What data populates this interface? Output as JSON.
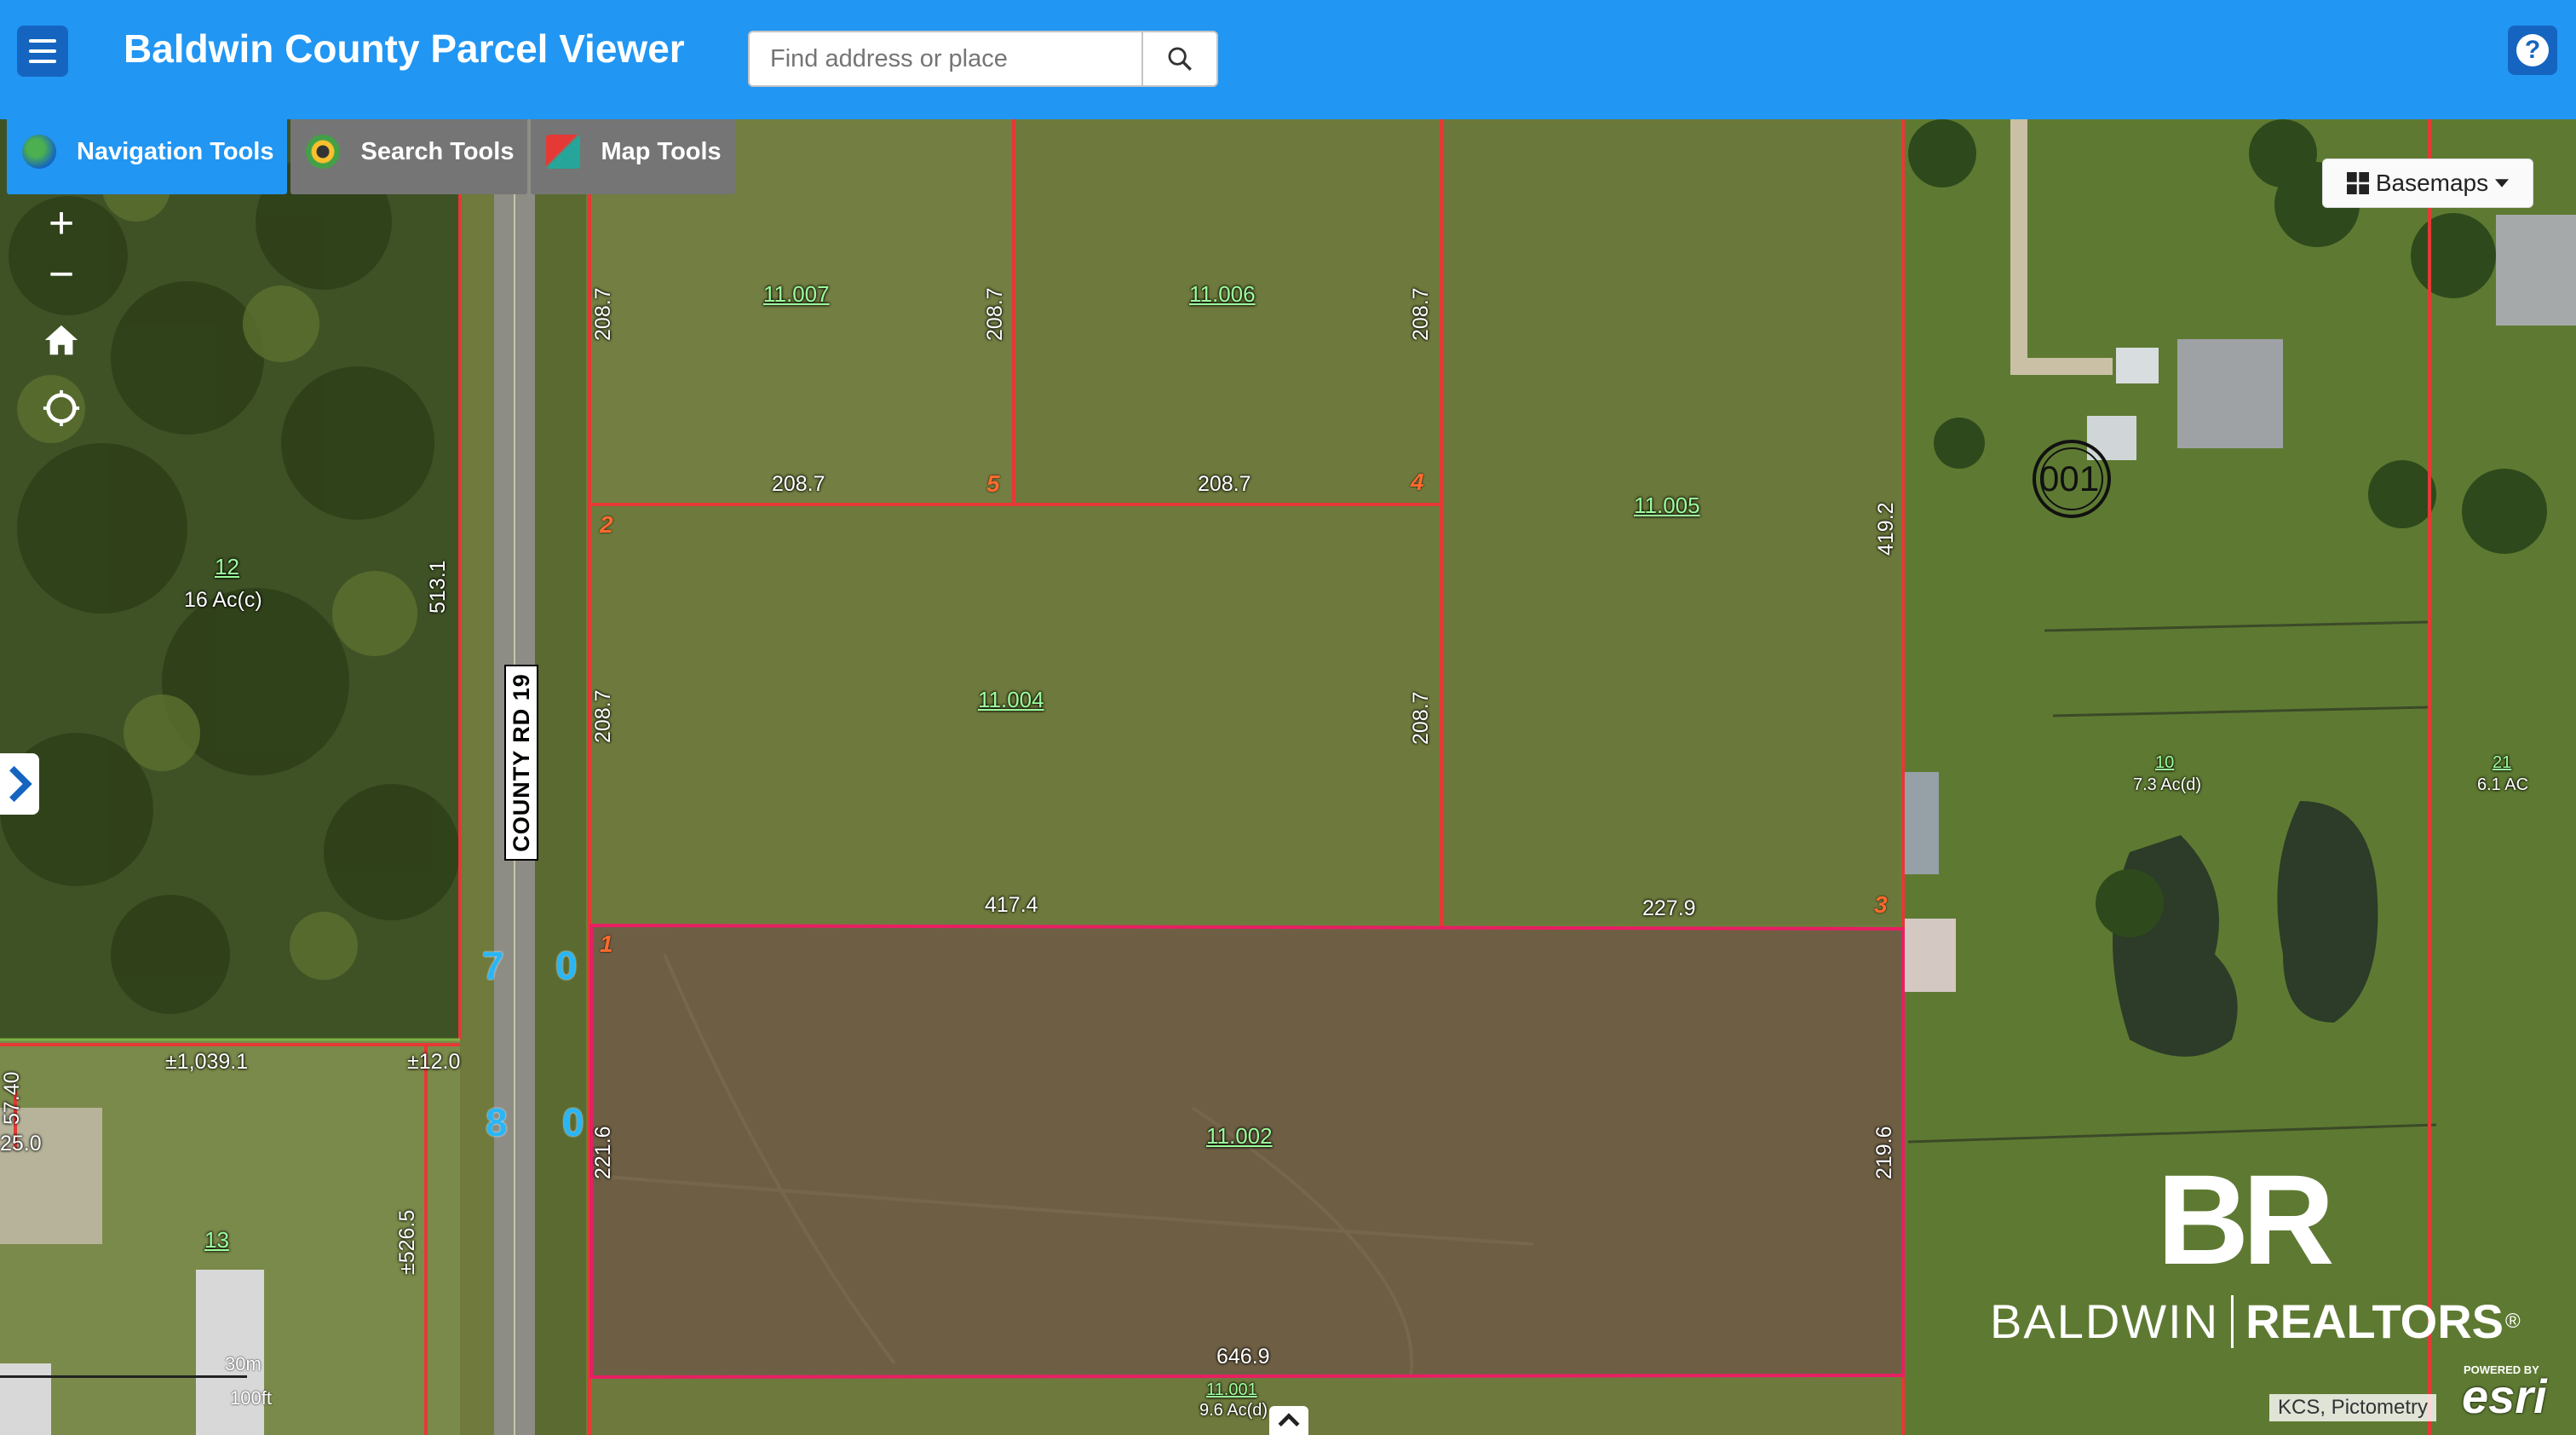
{
  "header": {
    "title": "Baldwin County Parcel Viewer",
    "search_placeholder": "Find address or place",
    "help_label": "?"
  },
  "tabs": [
    {
      "label": "Navigation Tools",
      "active": true
    },
    {
      "label": "Search Tools",
      "active": false
    },
    {
      "label": "Map Tools",
      "active": false
    }
  ],
  "map_controls": {
    "zoom_in": "+",
    "zoom_out": "−",
    "home": "home-icon",
    "locate": "locate-icon"
  },
  "basemaps": {
    "label": "Basemaps"
  },
  "road": {
    "name": "COUNTY RD 19"
  },
  "parcels": [
    {
      "id": "11.007"
    },
    {
      "id": "11.006"
    },
    {
      "id": "11.005"
    },
    {
      "id": "11.004"
    },
    {
      "id": "11.002"
    },
    {
      "id": "11.001",
      "acreage": "9.6 Ac(d)"
    },
    {
      "id": "12",
      "acreage": "16 Ac(c)"
    },
    {
      "id": "10",
      "acreage": "7.3 Ac(d)"
    },
    {
      "id": "21",
      "acreage": "6.1 AC"
    },
    {
      "id": "13"
    }
  ],
  "dimensions": {
    "d_208_7": "208.7",
    "d_417_4": "417.4",
    "d_227_9": "227.9",
    "d_646_9": "646.9",
    "d_419_2": "419.2",
    "d_221_6": "221.6",
    "d_219_6": "219.6",
    "d_513_1": "513.1",
    "d_1039_1": "±1,039.1",
    "d_12_0": "±12.0",
    "d_526_5": "±526.5",
    "d_25_0": "25.0",
    "d_57_40": "57.40"
  },
  "corners": {
    "c1": "1",
    "c2": "2",
    "c3": "3",
    "c4": "4",
    "c5": "5"
  },
  "grid_digits": {
    "a": "7",
    "b": "0",
    "c": "8",
    "d": "0"
  },
  "section_label": "001",
  "scale": {
    "metric": "30m",
    "imperial": "100ft"
  },
  "logo": {
    "line1": "BR",
    "line2": "BALDWIN",
    "line3": "REALTORS"
  },
  "attribution": "KCS, Pictometry",
  "esri": {
    "powered": "POWERED BY",
    "name": "esri"
  },
  "colors": {
    "header": "#2196f3",
    "parcel_line": "#e53935",
    "highlight_line": "#e91e63",
    "parcel_label": "#9cff9c"
  }
}
